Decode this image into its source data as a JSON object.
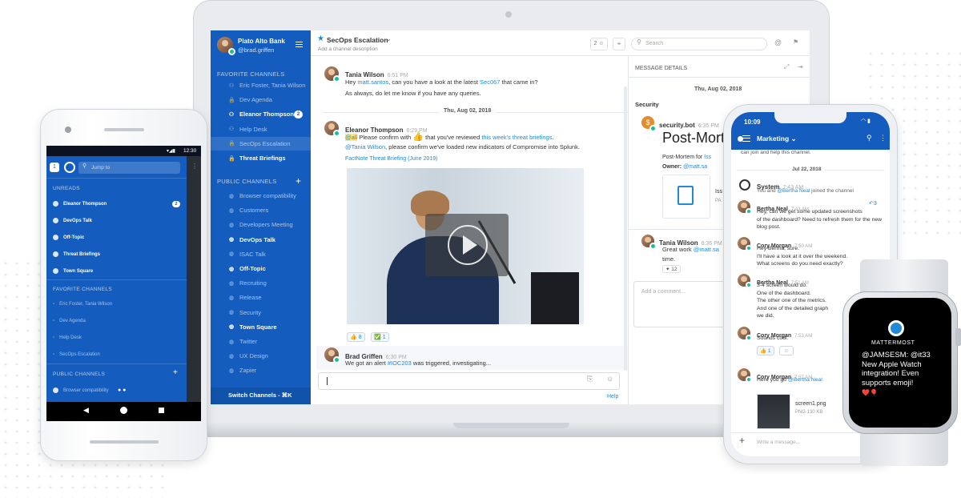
{
  "colors": {
    "accent": "#2389d7",
    "sidebar": "#145dbf",
    "online": "#1abc9c",
    "mention": "#ffe577"
  },
  "laptop": {
    "team": {
      "name": "Plato Alto Bank",
      "user": "@brad.griffen"
    },
    "header": {
      "channel": "SecOps Escalation",
      "desc": "Add a channel description",
      "members": "2",
      "search_placeholder": "Search"
    },
    "sidebar": {
      "favorites_title": "FAVORITE CHANNELS",
      "favorites": [
        {
          "label": "Eric Foster, Tania Wilson",
          "bold": false,
          "icon": "users-icon"
        },
        {
          "label": "Dev Agenda",
          "bold": false,
          "icon": "lock-icon"
        },
        {
          "label": "Eleanor Thompson",
          "bold": true,
          "icon": "users-icon",
          "badge": "2"
        },
        {
          "label": "Help Desk",
          "bold": false,
          "icon": "users-icon"
        },
        {
          "label": "SecOps Escalation",
          "bold": false,
          "icon": "lock-icon",
          "active": true
        },
        {
          "label": "Threat Briefings",
          "bold": true,
          "icon": "lock-icon"
        }
      ],
      "public_title": "PUBLIC CHANNELS",
      "public": [
        {
          "label": "Browser compatibility",
          "bold": false
        },
        {
          "label": "Customers",
          "bold": false
        },
        {
          "label": "Developers Meeting",
          "bold": false
        },
        {
          "label": "DevOps Talk",
          "bold": true
        },
        {
          "label": "ISAC Talk",
          "bold": false
        },
        {
          "label": "Off-Topic",
          "bold": true
        },
        {
          "label": "Recruiting",
          "bold": false
        },
        {
          "label": "Release",
          "bold": false
        },
        {
          "label": "Security",
          "bold": false
        },
        {
          "label": "Town Square",
          "bold": true
        },
        {
          "label": "Twitter",
          "bold": false
        },
        {
          "label": "UX Design",
          "bold": false
        },
        {
          "label": "Zapier",
          "bold": false
        }
      ],
      "switch": "Switch Channels - ⌘K"
    },
    "messages": {
      "m1": {
        "name": "Tania Wilson",
        "time": "6:51 PM",
        "pre": "Hey ",
        "mention": "matt.santos",
        "mid": ", can you have a look at the latest ",
        "link": "Sec067",
        "post": " that came in?",
        "line2": "As always, do let me know if you have any queries."
      },
      "date": "Thu, Aug 02, 2018",
      "m2": {
        "name": "Eleanor Thompson",
        "time": "6:29 PM",
        "atall": "@all",
        "pre": " Please confirm with ",
        "mid": " that you've reviewed ",
        "link": "this week's threat briefings",
        "post": ".",
        "mention2": "@Tania Wilson",
        "line2": ", please confirm we've loaded new indicators of Compromise into Splunk.",
        "attach": "FactNote Threat Briefing (June 2019)"
      },
      "reactions": [
        {
          "emoji": "👍",
          "count": "8"
        },
        {
          "emoji": "✅",
          "count": "1"
        }
      ],
      "m3": {
        "name": "Brad Griffen",
        "time": "6:30 PM",
        "pre": "We got an alert ",
        "link": "#IOC203",
        "post": " was triggered, investigating..."
      }
    },
    "help": "Help",
    "rhs": {
      "title": "MESSAGE DETAILS",
      "date": "Thu, Aug 02, 2018",
      "channel": "Security",
      "bot": "security.bot",
      "bot_time": "6:35 PM",
      "heading": "Post-Mort",
      "sub": "Post-Mortem for ",
      "sub_link": "Iss",
      "owner_label": "Owner: ",
      "owner": "@matt.sa",
      "file_name": "Iss",
      "file_type": "PA",
      "reply_name": "Tania Wilson",
      "reply_time": "6:36 PM",
      "reply_text": "Great work ",
      "reply_mention": "@matt.sa",
      "reply_text2": "time.",
      "reply_reaction": "12",
      "comment_placeholder": "Add a comment..."
    }
  },
  "android": {
    "time": "12:30",
    "search": "Jump to",
    "unreads_title": "UNREADS",
    "unreads": [
      {
        "label": "Eleanor Thompson",
        "badge": "2"
      },
      {
        "label": "DevOps Talk"
      },
      {
        "label": "Off-Topic"
      },
      {
        "label": "Threat Briefings"
      },
      {
        "label": "Town Square"
      }
    ],
    "fav_title": "FAVORITE CHANNELS",
    "favorites": [
      "Eric Foster, Tania Wilson",
      "Dev Agenda",
      "Help Desk",
      "SecOps Escalation"
    ],
    "public_title": "PUBLIC CHANNELS",
    "public": [
      "Browser compatibility"
    ]
  },
  "iphone": {
    "time": "10:09",
    "channel": "Marketing",
    "joined": "can join and help this channel.",
    "date": "Jul 22, 2018",
    "system": {
      "name": "System",
      "time": "7:43 AM",
      "pre": "You and ",
      "mention": "@Bertha Neal",
      "post": " joined the channel"
    },
    "posts": [
      {
        "name": "Bertha Neal",
        "time": "7:43 AM",
        "lines": [
          "Hey, can we get some updated screenshots",
          "of the dashboard? Need to refresh them for the new",
          "blog post."
        ],
        "reply": "3"
      },
      {
        "name": "Cory Morgan",
        "time": "7:50 AM",
        "lines": [
          "Hey Bertha, sure.",
          "I'll have a look at it over the weekend.",
          "What screens do you need exactly?"
        ]
      },
      {
        "name": "Bertha Neal",
        "time": "7:51 AM",
        "lines": [
          "3-4 screen would do.",
          "One of the dashboard.",
          "The other one of the metrics.",
          "And one of the detailed graph",
          "we did."
        ]
      },
      {
        "name": "Cory Morgan",
        "time": "7:53 AM",
        "lines": [
          "Sounds cool."
        ],
        "reaction": "1"
      },
      {
        "name": "Cory Morgan",
        "time": "7:57 AM",
        "pre": "Here you go ",
        "mention": "@Bertha Neal",
        "file": "screen1.png",
        "file_meta": "PNG 130 KB"
      }
    ],
    "input": "Write a message..."
  },
  "watch": {
    "brand": "MATTERMOST",
    "text": "@JAMSESM: @it33 New Apple Watch integration! Even supports emoji!",
    "emoji": "❤️🎈"
  }
}
